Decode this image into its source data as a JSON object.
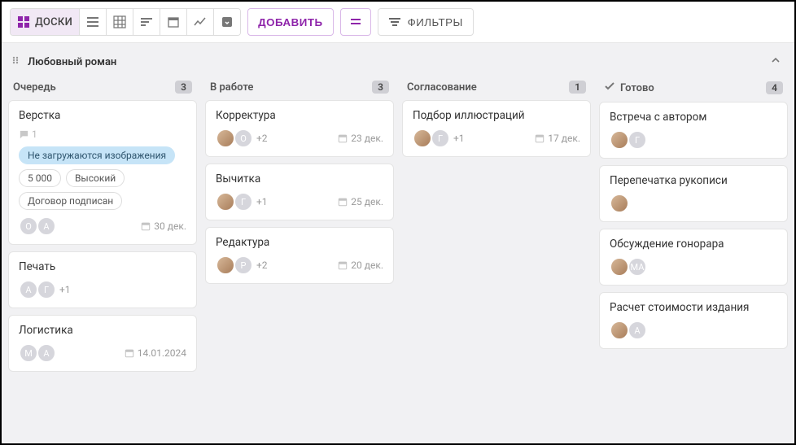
{
  "toolbar": {
    "boards_label": "ДОСКИ",
    "add_label": "ДОБАВИТЬ",
    "filters_label": "ФИЛЬТРЫ"
  },
  "board": {
    "title": "Любовный роман"
  },
  "columns": [
    {
      "title": "Очередь",
      "count": "3",
      "done": false,
      "cards": [
        {
          "title": "Верстка",
          "comments": "1",
          "tags": [
            {
              "text": "Не загружаются изображения",
              "style": "blue"
            },
            {
              "text": "5 000",
              "style": "plain"
            },
            {
              "text": "Высокий",
              "style": "plain"
            },
            {
              "text": "Договор подписан",
              "style": "plain"
            }
          ],
          "avatars": [
            {
              "type": "letter",
              "txt": "О"
            },
            {
              "type": "letter",
              "txt": "А"
            }
          ],
          "more": "",
          "date": "30 дек."
        },
        {
          "title": "Печать",
          "avatars": [
            {
              "type": "letter",
              "txt": "А"
            },
            {
              "type": "letter",
              "txt": "Г"
            }
          ],
          "more": "+1"
        },
        {
          "title": "Логистика",
          "avatars": [
            {
              "type": "letter",
              "txt": "М"
            },
            {
              "type": "letter",
              "txt": "А"
            }
          ],
          "date": "14.01.2024"
        }
      ]
    },
    {
      "title": "В работе",
      "count": "3",
      "done": false,
      "cards": [
        {
          "title": "Корректура",
          "avatars": [
            {
              "type": "img"
            },
            {
              "type": "letter",
              "txt": "О"
            }
          ],
          "more": "+2",
          "date": "23 дек."
        },
        {
          "title": "Вычитка",
          "avatars": [
            {
              "type": "img"
            },
            {
              "type": "letter",
              "txt": "Г"
            }
          ],
          "more": "+1",
          "date": "25 дек."
        },
        {
          "title": "Редактура",
          "avatars": [
            {
              "type": "img"
            },
            {
              "type": "letter",
              "txt": "Р"
            }
          ],
          "more": "+2",
          "date": "20 дек."
        }
      ]
    },
    {
      "title": "Согласование",
      "count": "1",
      "done": false,
      "cards": [
        {
          "title": "Подбор иллюстраций",
          "avatars": [
            {
              "type": "img"
            },
            {
              "type": "letter",
              "txt": "Г"
            }
          ],
          "more": "+1",
          "date": "17 дек."
        }
      ]
    },
    {
      "title": "Готово",
      "count": "4",
      "done": true,
      "cards": [
        {
          "title": "Встреча с автором",
          "avatars": [
            {
              "type": "img"
            },
            {
              "type": "letter",
              "txt": "Г"
            }
          ]
        },
        {
          "title": "Перепечатка рукописи",
          "avatars": [
            {
              "type": "img"
            }
          ]
        },
        {
          "title": "Обсуждение гонорара",
          "avatars": [
            {
              "type": "img"
            },
            {
              "type": "letter",
              "txt": "МА"
            }
          ]
        },
        {
          "title": "Расчет стоимости издания",
          "avatars": [
            {
              "type": "img"
            },
            {
              "type": "letter",
              "txt": "А"
            }
          ]
        }
      ]
    }
  ]
}
